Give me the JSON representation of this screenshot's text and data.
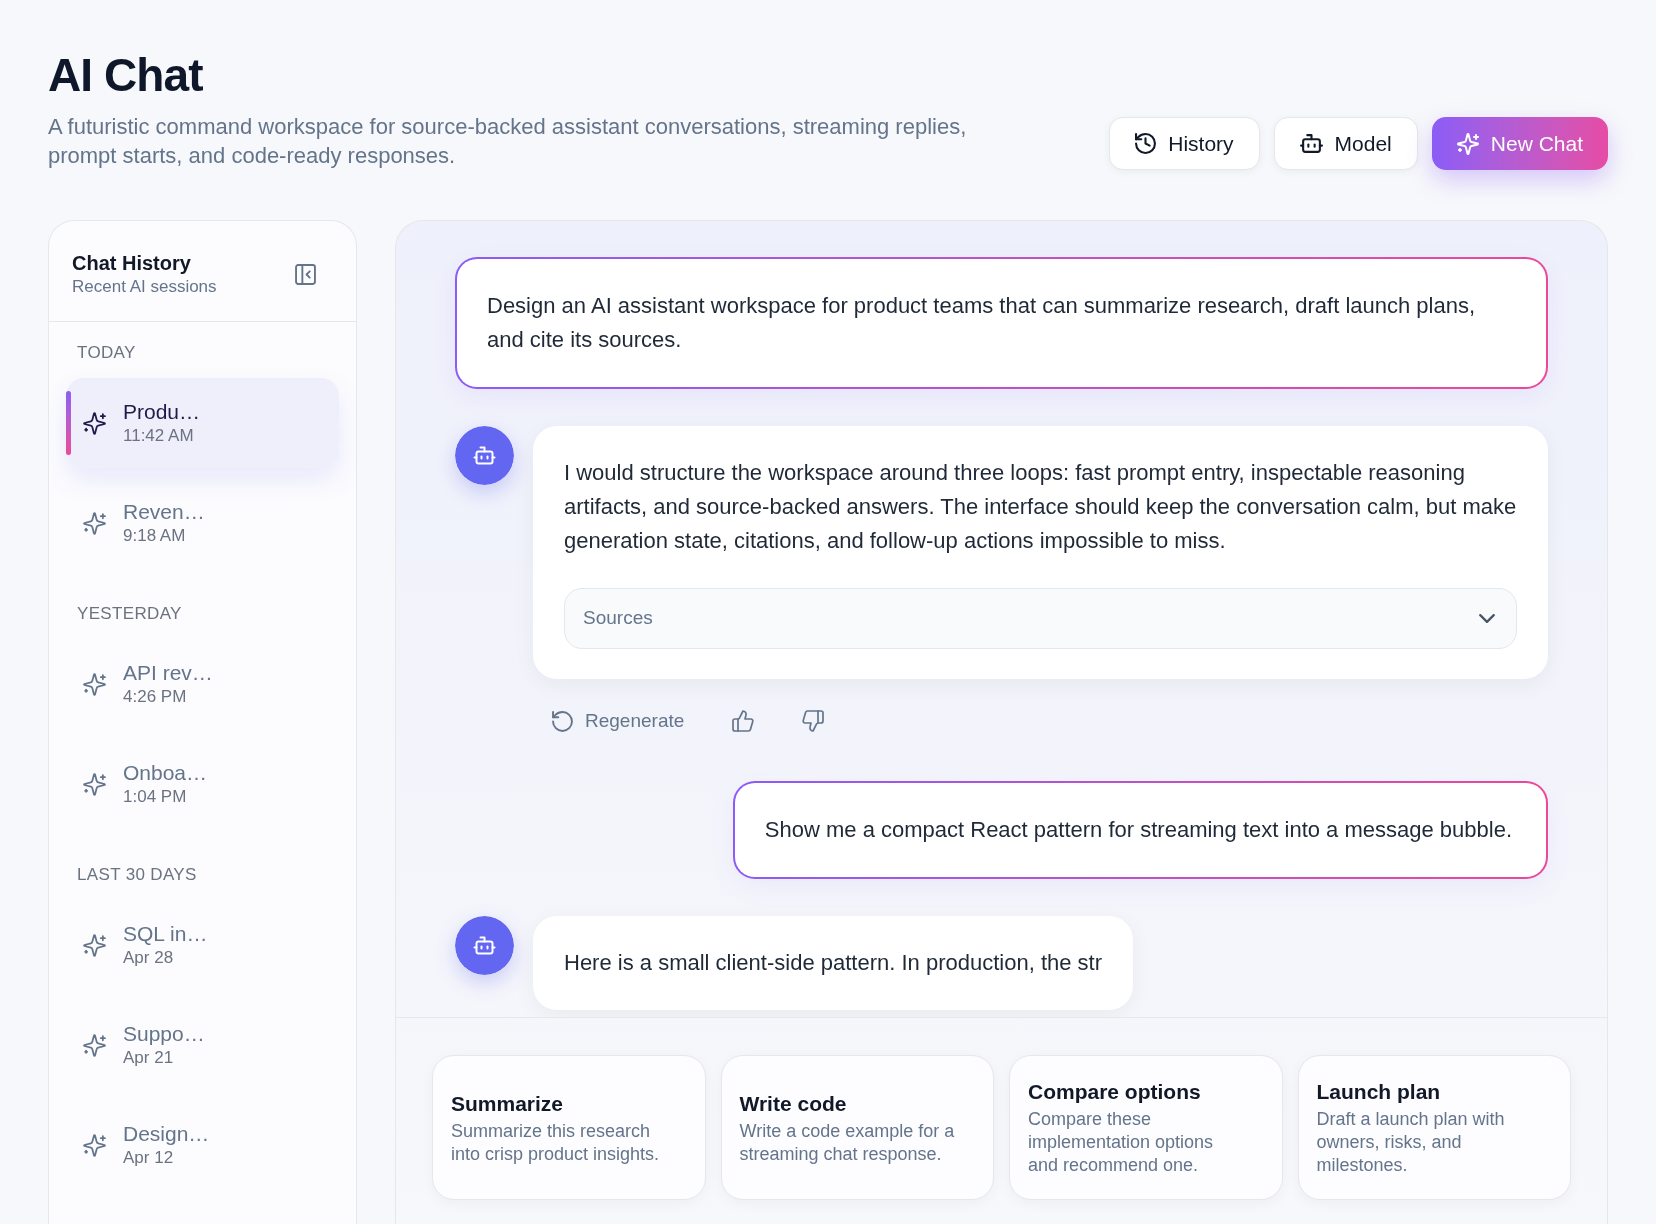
{
  "header": {
    "title": "AI Chat",
    "subtitle": "A futuristic command workspace for source-backed assistant conversations, streaming replies, prompt starts, and code-ready responses.",
    "buttons": [
      {
        "label": "History",
        "kind": "history"
      },
      {
        "label": "Model",
        "kind": "model"
      },
      {
        "label": "New Chat",
        "kind": "new"
      }
    ]
  },
  "sidebar": {
    "title": "Chat History",
    "subtitle": "Recent AI sessions",
    "groups": [
      {
        "label": "TODAY",
        "items": [
          {
            "title": "Produ…",
            "time": "11:42 AM",
            "selected": true
          },
          {
            "title": "Reven…",
            "time": "9:18 AM",
            "selected": false
          }
        ]
      },
      {
        "label": "YESTERDAY",
        "items": [
          {
            "title": "API rev…",
            "time": "4:26 PM",
            "selected": false
          },
          {
            "title": "Onboa…",
            "time": "1:04 PM",
            "selected": false
          }
        ]
      },
      {
        "label": "LAST 30 DAYS",
        "items": [
          {
            "title": "SQL in…",
            "time": "Apr 28",
            "selected": false
          },
          {
            "title": "Suppo…",
            "time": "Apr 21",
            "selected": false
          },
          {
            "title": "Design…",
            "time": "Apr 12",
            "selected": false
          }
        ]
      }
    ]
  },
  "chat": {
    "messages": [
      {
        "kind": "user",
        "text": "Design an AI assistant workspace for product teams that can summarize research, draft launch plans, and cite its sources."
      },
      {
        "kind": "assistant",
        "text": "I would structure the workspace around three loops: fast prompt entry, inspectable reasoning artifacts, and source-backed answers. The interface should keep the conversation calm, but make generation state, citations, and follow-up actions impossible to miss.",
        "sources": {
          "label": "Sources",
          "expanded": false
        },
        "actions": [
          {
            "kind": "regenerate",
            "label": "Regenerate"
          },
          {
            "kind": "like"
          },
          {
            "kind": "dislike"
          }
        ]
      },
      {
        "kind": "user",
        "text": "Show me a compact React pattern for streaming text into a message bubble."
      },
      {
        "kind": "assistant",
        "text": "Here is a small client-side pattern. In production, the str"
      }
    ],
    "prompts": [
      {
        "title": "Summarize",
        "text": "Summarize this research into crisp product insights."
      },
      {
        "title": "Write code",
        "text": "Write a code example for a streaming chat response."
      },
      {
        "title": "Compare options",
        "text": "Compare these implementation options and recommend one."
      },
      {
        "title": "Launch plan",
        "text": "Draft a launch plan with owners, risks, and milestones."
      }
    ]
  }
}
